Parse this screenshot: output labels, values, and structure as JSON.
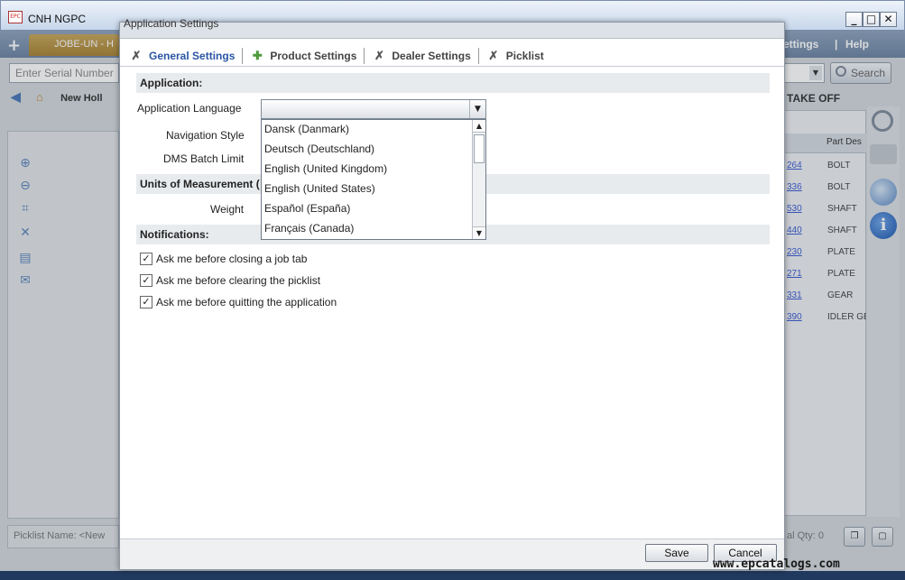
{
  "window": {
    "title": "CNH NGPC",
    "icon_label": "EPC",
    "minimize": "_",
    "maximize": "□",
    "close": "✕"
  },
  "background": {
    "job_tab": "JOBE-UN - H",
    "menu_items": [
      "ettings",
      "|",
      "Help"
    ],
    "serial_placeholder": "Enter Serial Number",
    "search_button": "Search",
    "breadcrumb": "New Holl",
    "take_off": "TAKE OFF",
    "grid_header": "Part Des",
    "grid_rows": [
      {
        "num": "264",
        "desc": "BOLT"
      },
      {
        "num": "336",
        "desc": "BOLT"
      },
      {
        "num": "530",
        "desc": "SHAFT"
      },
      {
        "num": "440",
        "desc": "SHAFT"
      },
      {
        "num": "230",
        "desc": "PLATE"
      },
      {
        "num": "271",
        "desc": "PLATE"
      },
      {
        "num": "331",
        "desc": "GEAR"
      },
      {
        "num": "390",
        "desc": "IDLER GE"
      }
    ],
    "picklist_label": "Picklist Name:  <New",
    "qty_label": "al Qty: 0"
  },
  "dialog": {
    "title": "Application Settings",
    "tabs": [
      {
        "label": "General Settings",
        "icon": "wrench-icon",
        "active": true
      },
      {
        "label": "Product Settings",
        "icon": "puzzle-icon",
        "active": false
      },
      {
        "label": "Dealer Settings",
        "icon": "wrench-icon",
        "active": false
      },
      {
        "label": "Picklist",
        "icon": "wrench-icon",
        "active": false
      }
    ],
    "sections": {
      "application": "Application:",
      "units": "Units of Measurement (",
      "notifications": "Notifications:"
    },
    "fields": {
      "application_language": "Application Language",
      "navigation_style": "Navigation Style",
      "dms_batch_limit": "DMS Batch Limit",
      "weight": "Weight"
    },
    "language_combo": {
      "selected": "",
      "options": [
        "Dansk (Danmark)",
        "Deutsch (Deutschland)",
        "English (United Kingdom)",
        "English (United States)",
        "Español (España)",
        "Français (Canada)"
      ]
    },
    "notifications": [
      {
        "label": "Ask me before closing a job tab",
        "checked": true
      },
      {
        "label": "Ask me before clearing the picklist",
        "checked": true
      },
      {
        "label": "Ask me before quitting the application",
        "checked": true
      }
    ],
    "buttons": {
      "save": "Save",
      "cancel": "Cancel"
    }
  },
  "watermark": "www.epcatalogs.com"
}
